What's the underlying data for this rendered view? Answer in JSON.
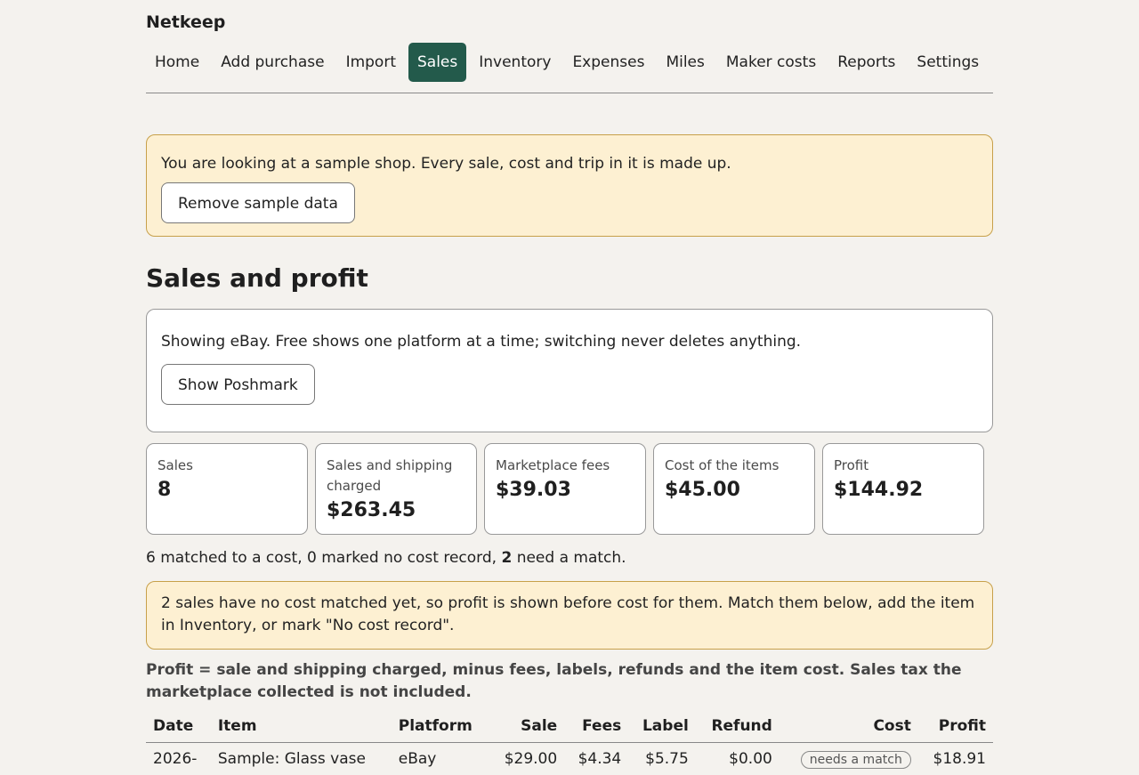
{
  "app": {
    "brand": "Netkeep"
  },
  "nav": {
    "items": [
      {
        "label": "Home"
      },
      {
        "label": "Add purchase"
      },
      {
        "label": "Import"
      },
      {
        "label": "Sales",
        "active": true
      },
      {
        "label": "Inventory"
      },
      {
        "label": "Expenses"
      },
      {
        "label": "Miles"
      },
      {
        "label": "Maker costs"
      },
      {
        "label": "Reports"
      },
      {
        "label": "Settings"
      }
    ]
  },
  "sample_banner": {
    "text": "You are looking at a sample shop. Every sale, cost and trip in it is made up.",
    "button": "Remove sample data"
  },
  "page": {
    "title": "Sales and profit"
  },
  "platform_card": {
    "text": "Showing eBay. Free shows one platform at a time; switching never deletes anything.",
    "button": "Show Poshmark"
  },
  "stats": [
    {
      "label": "Sales",
      "value": "8"
    },
    {
      "label": "Sales and shipping charged",
      "value": "$263.45"
    },
    {
      "label": "Marketplace fees",
      "value": "$39.03"
    },
    {
      "label": "Cost of the items",
      "value": "$45.00"
    },
    {
      "label": "Profit",
      "value": "$144.92"
    }
  ],
  "match_summary": {
    "before": "6 matched to a cost, 0 marked no cost record,",
    "count": "2",
    "after": "need a match."
  },
  "warning": {
    "text": "2 sales have no cost matched yet, so profit is shown before cost for them. Match them below, add the item in Inventory, or mark \"No cost record\"."
  },
  "formula": "Profit = sale and shipping charged, minus fees, labels, refunds and the item cost. Sales tax the marketplace collected is not included.",
  "table": {
    "headers": {
      "date": "Date",
      "item": "Item",
      "platform": "Platform",
      "sale": "Sale",
      "fees": "Fees",
      "label": "Label",
      "refund": "Refund",
      "cost": "Cost",
      "profit": "Profit"
    },
    "rows": [
      {
        "date": "2026-",
        "item": "Sample: Glass vase",
        "platform": "eBay",
        "sale": "$29.00",
        "fees": "$4.34",
        "label": "$5.75",
        "refund": "$0.00",
        "cost": "needs a match",
        "profit": "$18.91"
      }
    ]
  },
  "colors": {
    "accent": "#235a4b",
    "banner_bg": "#fdf0d2",
    "profit_positive": "#2e7a3a"
  }
}
